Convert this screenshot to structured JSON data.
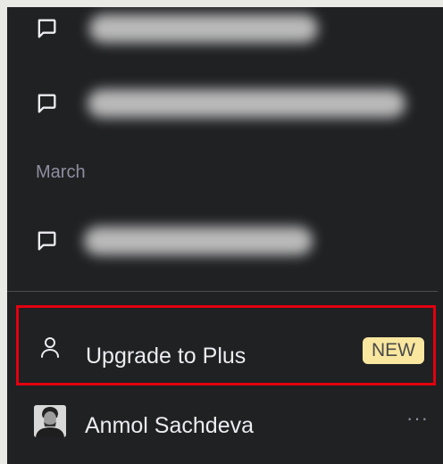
{
  "sidebar": {
    "chats": [
      {
        "icon": "chat-bubble-icon",
        "title_blurred": true
      },
      {
        "icon": "chat-bubble-icon",
        "title_blurred": true
      },
      {
        "icon": "chat-bubble-icon",
        "title_blurred": true
      }
    ],
    "section_label": "March",
    "upgrade": {
      "icon": "user-icon",
      "label": "Upgrade to Plus",
      "badge": "NEW",
      "badge_color": "#f9e79f",
      "highlight_color": "#e3000f"
    },
    "profile": {
      "name": "Anmol Sachdeva",
      "menu_icon": "ellipsis-icon",
      "menu_glyph": "···"
    }
  },
  "colors": {
    "sidebar_bg": "#202123",
    "text": "#ececf1",
    "muted_text": "#8e8ea0"
  }
}
